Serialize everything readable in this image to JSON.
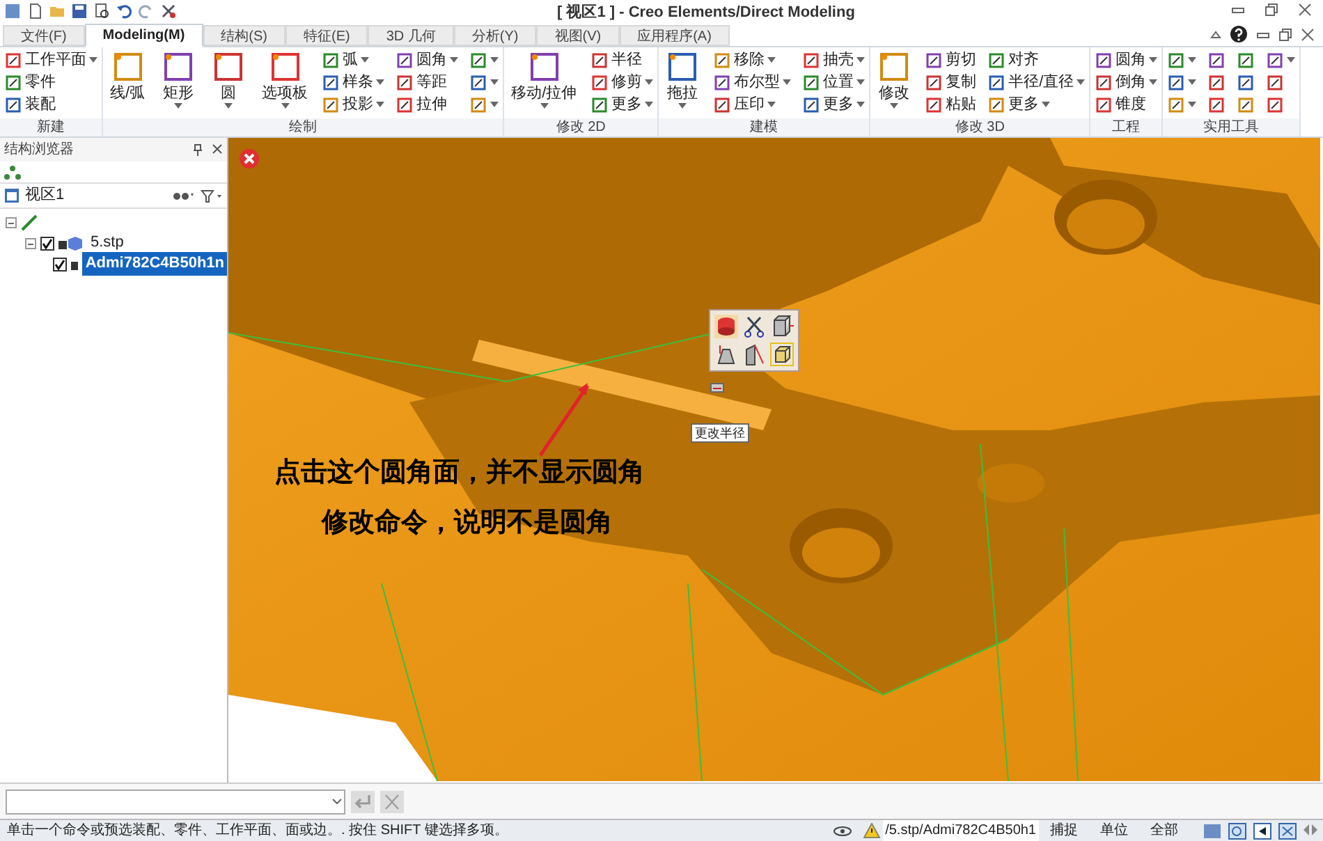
{
  "window": {
    "title": "[ 视区1 ] - Creo Elements/Direct Modeling"
  },
  "tabs": [
    {
      "label": "文件(F)",
      "selected": false
    },
    {
      "label": "Modeling(M)",
      "selected": true
    },
    {
      "label": "结构(S)",
      "selected": false
    },
    {
      "label": "特征(E)",
      "selected": false
    },
    {
      "label": "3D 几何",
      "selected": false
    },
    {
      "label": "分析(Y)",
      "selected": false
    },
    {
      "label": "视图(V)",
      "selected": false
    },
    {
      "label": "应用程序(A)",
      "selected": false
    }
  ],
  "ribbon": [
    {
      "label": "新建",
      "items": [
        {
          "kind": "small",
          "label": "工作平面",
          "dropdown": true
        },
        {
          "kind": "small",
          "label": "零件",
          "dropdown": false
        },
        {
          "kind": "small",
          "label": "装配",
          "dropdown": false
        }
      ]
    },
    {
      "label": "绘制",
      "items": [
        {
          "kind": "large",
          "label": "线/弧",
          "dropdown": false
        },
        {
          "kind": "large",
          "label": "矩形",
          "dropdown": true
        },
        {
          "kind": "large",
          "label": "圆",
          "dropdown": true
        },
        {
          "kind": "large",
          "label": "选项板",
          "dropdown": true
        },
        {
          "kind": "small",
          "label": "弧",
          "dropdown": true
        },
        {
          "kind": "small",
          "label": "样条",
          "dropdown": true
        },
        {
          "kind": "small",
          "label": "投影",
          "dropdown": true
        },
        {
          "kind": "small",
          "label": "圆角",
          "dropdown": true
        },
        {
          "kind": "small",
          "label": "等距",
          "dropdown": false
        },
        {
          "kind": "small",
          "label": "拉伸",
          "dropdown": false
        },
        {
          "kind": "icon",
          "dropdown": true
        },
        {
          "kind": "icon",
          "dropdown": true
        },
        {
          "kind": "icon",
          "dropdown": true
        }
      ]
    },
    {
      "label": "修改 2D",
      "items": [
        {
          "kind": "large",
          "label": "移动/拉伸",
          "dropdown": true
        },
        {
          "kind": "small",
          "label": "半径",
          "dropdown": false
        },
        {
          "kind": "small",
          "label": "修剪",
          "dropdown": true
        },
        {
          "kind": "small",
          "label": "更多",
          "dropdown": true
        }
      ]
    },
    {
      "label": "建模",
      "items": [
        {
          "kind": "large",
          "label": "拖拉",
          "dropdown": true
        },
        {
          "kind": "small",
          "label": "移除",
          "dropdown": true
        },
        {
          "kind": "small",
          "label": "布尔型",
          "dropdown": true
        },
        {
          "kind": "small",
          "label": "压印",
          "dropdown": true
        },
        {
          "kind": "small",
          "label": "抽壳",
          "dropdown": true
        },
        {
          "kind": "small",
          "label": "位置",
          "dropdown": true
        },
        {
          "kind": "small",
          "label": "更多",
          "dropdown": true
        }
      ]
    },
    {
      "label": "修改 3D",
      "items": [
        {
          "kind": "large",
          "label": "修改",
          "dropdown": true
        },
        {
          "kind": "small",
          "label": "剪切",
          "dropdown": false
        },
        {
          "kind": "small",
          "label": "复制",
          "dropdown": false
        },
        {
          "kind": "small",
          "label": "粘贴",
          "dropdown": false
        },
        {
          "kind": "small",
          "label": "对齐",
          "dropdown": false
        },
        {
          "kind": "small",
          "label": "半径/直径",
          "dropdown": true
        },
        {
          "kind": "small",
          "label": "更多",
          "dropdown": true
        }
      ]
    },
    {
      "label": "工程",
      "items": [
        {
          "kind": "small",
          "label": "圆角",
          "dropdown": true
        },
        {
          "kind": "small",
          "label": "倒角",
          "dropdown": true
        },
        {
          "kind": "small",
          "label": "锥度",
          "dropdown": false
        }
      ]
    },
    {
      "label": "实用工具",
      "items": [
        {
          "kind": "icon",
          "dropdown": true
        },
        {
          "kind": "icon",
          "dropdown": true
        },
        {
          "kind": "icon",
          "dropdown": true
        },
        {
          "kind": "icon",
          "dropdown": false
        },
        {
          "kind": "icon",
          "dropdown": false
        },
        {
          "kind": "icon",
          "dropdown": false
        },
        {
          "kind": "icon",
          "dropdown": false
        },
        {
          "kind": "icon",
          "dropdown": false
        },
        {
          "kind": "icon",
          "dropdown": false
        },
        {
          "kind": "icon",
          "dropdown": true
        },
        {
          "kind": "icon",
          "dropdown": false
        },
        {
          "kind": "icon",
          "dropdown": false
        }
      ]
    }
  ],
  "browser": {
    "title": "结构浏览器",
    "view": "视区1",
    "tree": [
      {
        "kind": "root",
        "expanded": true,
        "children": [
          {
            "label": "5.stp",
            "checked": true,
            "selected": false,
            "expanded": true,
            "children": [
              {
                "label": "Admi782C4B50h1n",
                "checked": true,
                "selected": true
              }
            ]
          }
        ]
      }
    ]
  },
  "viewport": {
    "tooltip": "更改半径",
    "annotation": [
      "点击这个圆角面，并不显示圆角",
      "修改命令，说明不是圆角"
    ]
  },
  "status_bar": {
    "message": "单击一个命令或预选装配、零件、工作平面、面或边。. 按住 SHIFT 键选择多项。",
    "path": "/5.stp/Admi782C4B50h1",
    "fields": [
      "捕捉",
      "单位",
      "全部"
    ]
  }
}
